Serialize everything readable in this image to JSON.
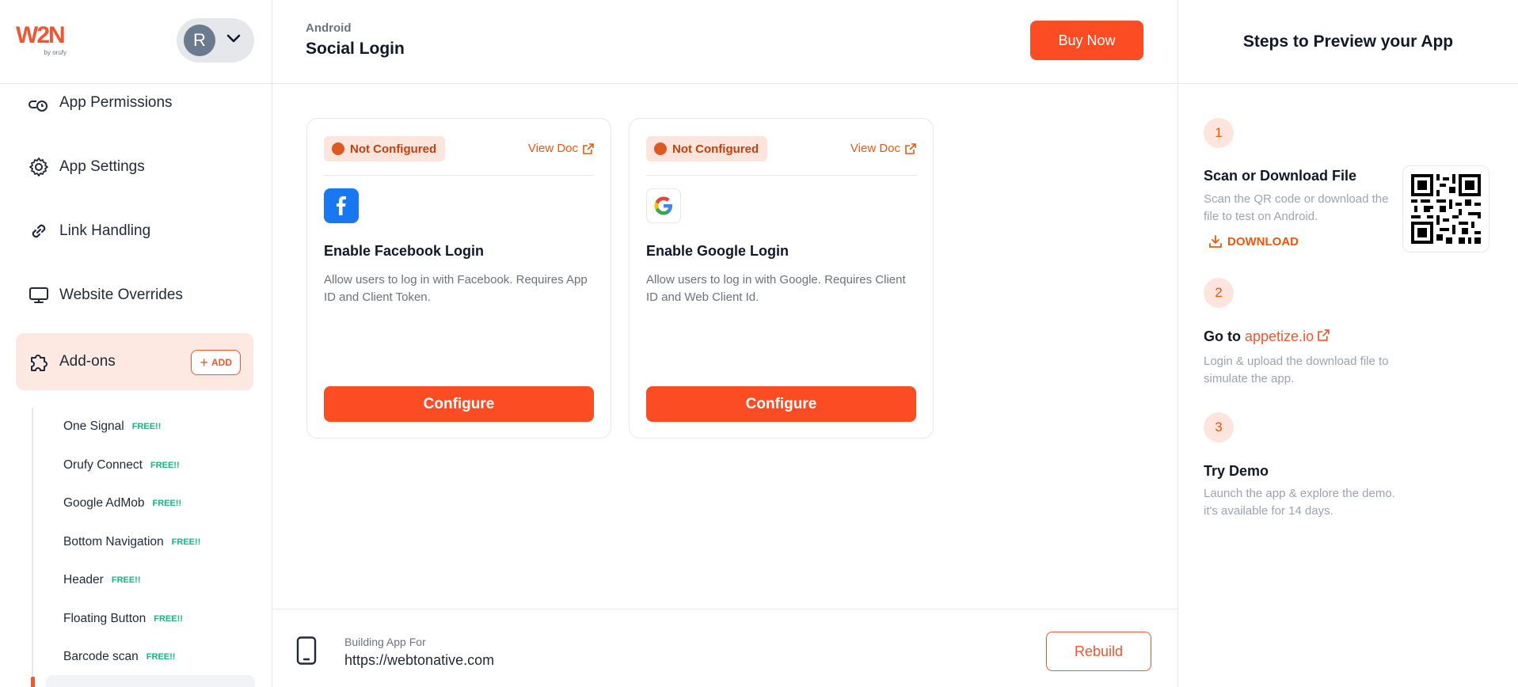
{
  "sidebar": {
    "logo_main": "W2N",
    "logo_sub": "by orufy",
    "user_initial": "R",
    "nav": [
      {
        "label": "App Permissions",
        "icon": "permissions-icon"
      },
      {
        "label": "App Settings",
        "icon": "gear-icon"
      },
      {
        "label": "Link Handling",
        "icon": "link-icon"
      },
      {
        "label": "Website Overrides",
        "icon": "monitor-icon"
      },
      {
        "label": "Add-ons",
        "icon": "puzzle-icon"
      }
    ],
    "add_label": "ADD",
    "addons": [
      {
        "label": "One Signal",
        "badge": "FREE!!"
      },
      {
        "label": "Orufy Connect",
        "badge": "FREE!!"
      },
      {
        "label": "Google AdMob",
        "badge": "FREE!!"
      },
      {
        "label": "Bottom Navigation",
        "badge": "FREE!!"
      },
      {
        "label": "Header",
        "badge": "FREE!!"
      },
      {
        "label": "Floating Button",
        "badge": "FREE!!"
      },
      {
        "label": "Barcode scan",
        "badge": "FREE!!"
      }
    ]
  },
  "header": {
    "platform": "Android",
    "title": "Social Login",
    "buy_label": "Buy Now"
  },
  "cards": [
    {
      "status": "Not Configured",
      "view_doc": "View Doc",
      "title": "Enable Facebook Login",
      "desc": "Allow users to log in with Facebook. Requires App ID and Client Token.",
      "button": "Configure",
      "icon": "facebook-icon"
    },
    {
      "status": "Not Configured",
      "view_doc": "View Doc",
      "title": "Enable Google Login",
      "desc": "Allow users to log in with Google. Requires Client ID and Web Client Id.",
      "button": "Configure",
      "icon": "google-icon"
    }
  ],
  "footer": {
    "label": "Building App For",
    "url": "https://webtonative.com",
    "rebuild_label": "Rebuild"
  },
  "preview": {
    "title": "Steps to Preview your App",
    "steps": [
      {
        "num": "1",
        "title": "Scan or Download File",
        "desc": "Scan the QR code or download the file to test on Android.",
        "action": "DOWNLOAD"
      },
      {
        "num": "2",
        "title_prefix": "Go to",
        "link": "appetize.io",
        "desc": "Login & upload the download file to simulate the app."
      },
      {
        "num": "3",
        "title": "Try Demo",
        "desc": "Launch the app & explore the demo. it's available for 14 days."
      }
    ]
  },
  "colors": {
    "accent": "#fc4c24",
    "badge_bg": "#fde4dc",
    "free_green": "#10b981",
    "facebook_blue": "#1877f2"
  }
}
